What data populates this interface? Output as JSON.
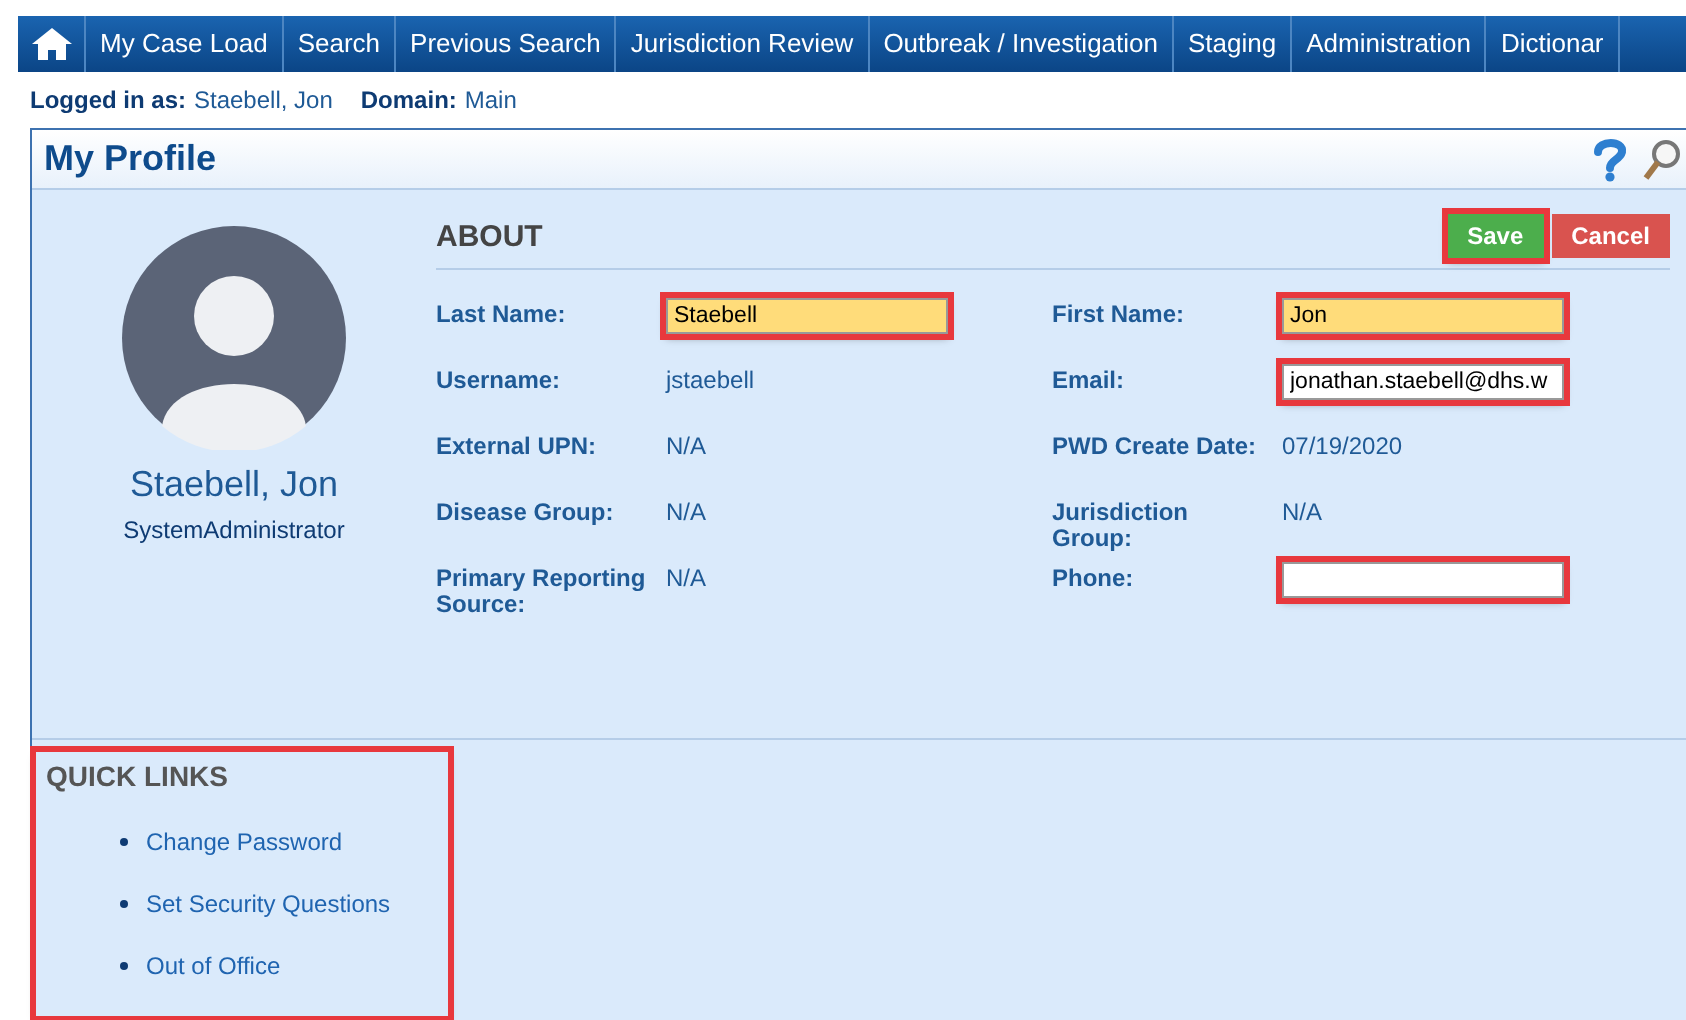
{
  "nav": {
    "items": [
      {
        "label": "My Case Load"
      },
      {
        "label": "Search"
      },
      {
        "label": "Previous Search"
      },
      {
        "label": "Jurisdiction Review"
      },
      {
        "label": "Outbreak / Investigation"
      },
      {
        "label": "Staging"
      },
      {
        "label": "Administration"
      },
      {
        "label": "Dictionar"
      }
    ]
  },
  "login_bar": [
    {
      "label": "Logged in as:",
      "value": "Staebell, Jon"
    },
    {
      "label": "Domain:",
      "value": "Main"
    }
  ],
  "page_title": "My Profile",
  "profile": {
    "name": "Staebell, Jon",
    "role": "SystemAdministrator"
  },
  "about": {
    "heading": "ABOUT",
    "buttons": [
      {
        "label": "Save",
        "kind": "primary",
        "highlighted": true
      },
      {
        "label": "Cancel",
        "kind": "danger",
        "highlighted": false
      }
    ],
    "fields": [
      {
        "label": "Last Name:",
        "kind": "input",
        "value": "Staebell",
        "required": true,
        "highlighted": true
      },
      {
        "label": "First Name:",
        "kind": "input",
        "value": "Jon",
        "required": true,
        "highlighted": true
      },
      {
        "label": "Username:",
        "kind": "text",
        "value": "jstaebell"
      },
      {
        "label": "Email:",
        "kind": "input",
        "value": "jonathan.staebell@dhs.w",
        "required": false,
        "highlighted": true
      },
      {
        "label": "External UPN:",
        "kind": "text",
        "value": "N/A"
      },
      {
        "label": "PWD Create Date:",
        "kind": "text",
        "value": "07/19/2020"
      },
      {
        "label": "Disease Group:",
        "kind": "text",
        "value": "N/A"
      },
      {
        "label": "Jurisdiction Group:",
        "kind": "text",
        "value": "N/A"
      },
      {
        "label": "Primary Reporting Source:",
        "kind": "text",
        "value": "N/A"
      },
      {
        "label": "Phone:",
        "kind": "input",
        "required": false,
        "highlighted": true
      }
    ]
  },
  "quick_links": {
    "heading": "QUICK LINKS",
    "highlighted": true,
    "items": [
      {
        "label": "Change Password"
      },
      {
        "label": "Set Security Questions"
      },
      {
        "label": "Out of Office"
      }
    ]
  }
}
